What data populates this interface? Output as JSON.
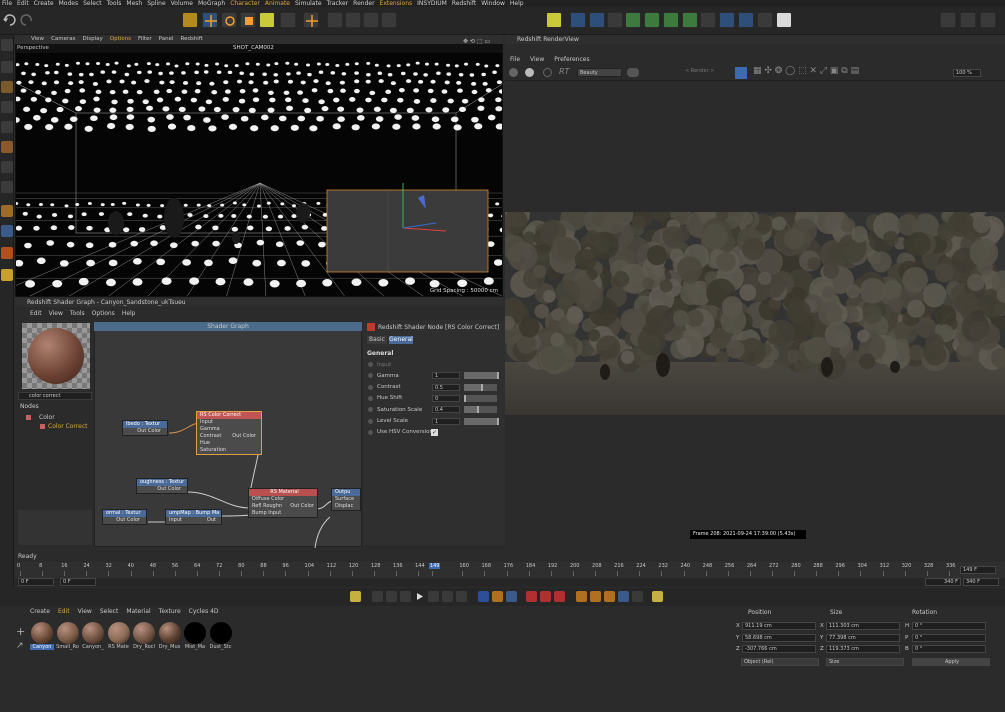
{
  "menubar": {
    "items": [
      "File",
      "Edit",
      "Create",
      "Modes",
      "Select",
      "Tools",
      "Mesh",
      "Spline",
      "Volume",
      "MoGraph",
      "Character",
      "Animate",
      "Simulate",
      "Tracker",
      "Render",
      "Extensions",
      "INSYDIUM",
      "Redshift",
      "Window",
      "Help"
    ]
  },
  "viewport": {
    "menu": [
      "View",
      "Cameras",
      "Display",
      "Options",
      "Filter",
      "Panel",
      "Redshift"
    ],
    "active_menu": "Options",
    "label": "Perspective",
    "camera": "SHOT_CAM002",
    "grid_spacing": "Grid Spacing : 50000 cm"
  },
  "renderview": {
    "title": "Redshift RenderView",
    "menu": [
      "File",
      "View",
      "Preferences"
    ],
    "aov": "Beauty",
    "zoom": "100 %",
    "render_mode": "< Render >",
    "frame_info": "Frame 208: 2021-09-24 17:39:00 (5.43s)"
  },
  "shader": {
    "title": "Redshift Shader Graph - Canyon_Sandstone_ukTsueu",
    "menu": [
      "Edit",
      "View",
      "Tools",
      "Options",
      "Help"
    ],
    "graph_title": "Shader Graph",
    "search": "color correct",
    "tree_title": "Nodes",
    "tree": [
      "Color",
      "Color Correct"
    ],
    "nodes": {
      "albedo": {
        "title": "lbedo : Textur",
        "out": "Out Color"
      },
      "cc": {
        "title": "RS Color Correct",
        "rows": [
          "Input",
          "Gamma",
          "Contrast",
          "Hue",
          "Saturation"
        ],
        "out": "Out Color"
      },
      "rough": {
        "title": "oughness : Textur",
        "out": "Out Color"
      },
      "normal": {
        "title": "ormal : Textur",
        "out": "Out Color"
      },
      "bump": {
        "title": "umpMap : Bump Ma",
        "in": "Input",
        "out": "Out"
      },
      "rsmat": {
        "title": "RS Material",
        "rows": [
          "Diffuse Color",
          "Refl Roughn",
          "Bump Input"
        ],
        "out": "Out Color"
      },
      "output": {
        "title": "Outpu",
        "rows": [
          "Surface",
          "Displac"
        ]
      }
    }
  },
  "attributes": {
    "title": "Redshift Shader Node [RS Color Correct]",
    "tabs": [
      "Basic",
      "General"
    ],
    "section": "General",
    "rows": [
      {
        "label": "Input",
        "value": ""
      },
      {
        "label": "Gamma",
        "value": "1"
      },
      {
        "label": "Contrast",
        "value": "0.5"
      },
      {
        "label": "Hue Shift",
        "value": "0"
      },
      {
        "label": "Saturation Scale",
        "value": "0.4"
      },
      {
        "label": "Level Scale",
        "value": "1"
      },
      {
        "label": "Use HSV Conversion",
        "value": ""
      }
    ]
  },
  "status": "Ready",
  "timeline": {
    "ticks": [
      "0",
      "8",
      "16",
      "24",
      "32",
      "40",
      "48",
      "56",
      "64",
      "72",
      "80",
      "88",
      "96",
      "104",
      "112",
      "120",
      "128",
      "136",
      "144",
      "149",
      "160",
      "168",
      "176",
      "184",
      "192",
      "200",
      "208",
      "216",
      "224",
      "232",
      "240",
      "248",
      "256",
      "264",
      "272",
      "280",
      "288",
      "296",
      "304",
      "312",
      "320",
      "328",
      "336"
    ],
    "current": "149",
    "end_field": "149 F",
    "start": "0 F",
    "start2": "0 F",
    "end": "340 F",
    "end2": "340 F"
  },
  "materials": {
    "menu": [
      "Create",
      "Edit",
      "View",
      "Select",
      "Material",
      "Texture",
      "Cycles 4D"
    ],
    "items": [
      {
        "label": "Canyon",
        "color": "#6b4a38"
      },
      {
        "label": "Small_Ro",
        "color": "#7a5b45"
      },
      {
        "label": "Canyon_",
        "color": "#6e5040"
      },
      {
        "label": "RS Mate",
        "color": "#8a6a55"
      },
      {
        "label": "Dry_Rocl",
        "color": "#735543"
      },
      {
        "label": "Dry_Mus",
        "color": "#5a4030"
      },
      {
        "label": "Mist_Ma",
        "color": "#000000"
      },
      {
        "label": "Dust_Stc",
        "color": "#000000"
      }
    ]
  },
  "coords": {
    "headers": [
      "Position",
      "Size",
      "Rotation"
    ],
    "rows": [
      {
        "a": "X",
        "pos": "911.19 cm",
        "b": "X",
        "size": "111.303 cm",
        "c": "H",
        "rot": "0 °"
      },
      {
        "a": "Y",
        "pos": "58.698 cm",
        "b": "Y",
        "size": "77.398 cm",
        "c": "P",
        "rot": "0 °"
      },
      {
        "a": "Z",
        "pos": "-307.766 cm",
        "b": "Z",
        "size": "119.373 cm",
        "c": "B",
        "rot": "0 °"
      }
    ],
    "mode": "Object (Rel)",
    "size_mode": "Size",
    "apply": "Apply"
  }
}
